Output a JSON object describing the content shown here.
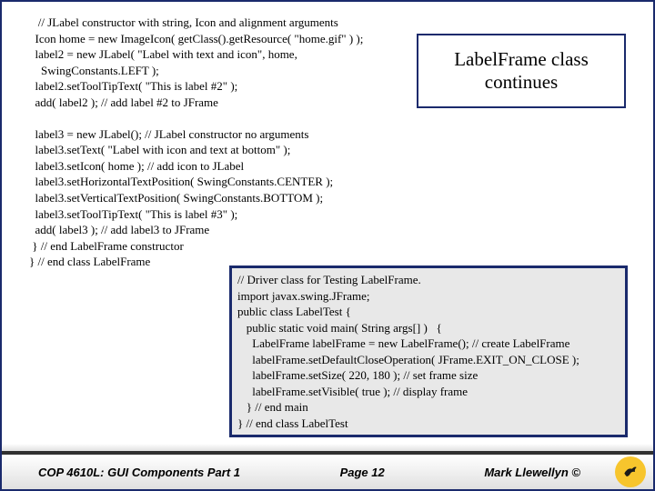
{
  "code_block1": "   // JLabel constructor with string, Icon and alignment arguments\n  Icon home = new ImageIcon( getClass().getResource( \"home.gif\" ) );\n  label2 = new JLabel( \"Label with text and icon\", home,\n    SwingConstants.LEFT );\n  label2.setToolTipText( \"This is label #2\" );\n  add( label2 ); // add label #2 to JFrame\n\n  label3 = new JLabel(); // JLabel constructor no arguments\n  label3.setText( \"Label with icon and text at bottom\" );\n  label3.setIcon( home ); // add icon to JLabel\n  label3.setHorizontalTextPosition( SwingConstants.CENTER );\n  label3.setVerticalTextPosition( SwingConstants.BOTTOM );\n  label3.setToolTipText( \"This is label #3\" );\n  add( label3 ); // add label3 to JFrame\n } // end LabelFrame constructor\n} // end class LabelFrame",
  "callout_text": "LabelFrame class continues",
  "driver_code": "// Driver class for Testing LabelFrame.\nimport javax.swing.JFrame;\npublic class LabelTest {\n   public static void main( String args[] )   {\n     LabelFrame labelFrame = new LabelFrame(); // create LabelFrame\n     labelFrame.setDefaultCloseOperation( JFrame.EXIT_ON_CLOSE );\n     labelFrame.setSize( 220, 180 ); // set frame size\n     labelFrame.setVisible( true ); // display frame\n   } // end main\n} // end class LabelTest",
  "footer": {
    "left": "COP 4610L: GUI Components Part 1",
    "center": "Page 12",
    "right": "Mark Llewellyn ©"
  }
}
